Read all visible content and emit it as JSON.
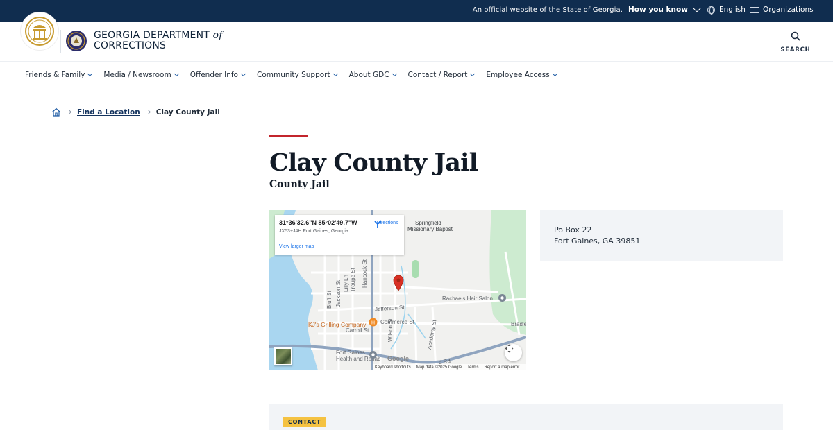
{
  "utility_bar": {
    "official_text": "An official website of the State of Georgia.",
    "how_you_know": "How you know",
    "language": "English",
    "organizations": "Organizations"
  },
  "header": {
    "brand_line1": "GEORGIA DEPARTMENT",
    "brand_of": "of",
    "brand_line2": "CORRECTIONS",
    "search_label": "SEARCH"
  },
  "nav": {
    "items": [
      {
        "label": "Friends & Family"
      },
      {
        "label": "Media / Newsroom"
      },
      {
        "label": "Offender Info"
      },
      {
        "label": "Community Support"
      },
      {
        "label": "About GDC"
      },
      {
        "label": "Contact / Report"
      },
      {
        "label": "Employee Access"
      }
    ]
  },
  "breadcrumb": {
    "parent": "Find a Location",
    "current": "Clay County Jail"
  },
  "page": {
    "title": "Clay County Jail",
    "subtitle": "County Jail"
  },
  "map": {
    "coordinates": "31°36'32.6\"N 85°02'49.7\"W",
    "plus_code": "JX53+J4H Fort Gaines, Georgia",
    "directions": "Directions",
    "view_larger": "View larger map",
    "labels": {
      "springfield_1": "Springfield",
      "springfield_2": "Missionary Baptist",
      "rachaels": "Rachaels Hair Salon",
      "jefferson": "Jefferson St",
      "commerce": "Commerce St",
      "kjs": "KJ's Grilling Company",
      "carroll": "Carroll St",
      "fort_gaines_1": "Fort Gaines",
      "fort_gaines_2": "Health and Rehab",
      "bradley": "Bradley",
      "hancock": "Hancock St",
      "wilson": "Wilson St",
      "academy": "Academy St",
      "troupe": "Troupe St",
      "jackson": "Jackson St",
      "lilly": "Lilly Ln",
      "bluff": "Bluff St",
      "rd": "d Rd",
      "google": "Google"
    },
    "footer": {
      "keyboard": "Keyboard shortcuts",
      "mapdata": "Map data ©2025 Google",
      "terms": "Terms",
      "report": "Report a map error"
    }
  },
  "address": {
    "line1": "Po Box 22",
    "line2": "Fort Gaines, GA 39851"
  },
  "contact": {
    "badge": "CONTACT"
  },
  "colors": {
    "topbar": "#102d4f",
    "accent_red": "#c3252c",
    "link_blue": "#1d5aa3",
    "badge_yellow": "#f5c242",
    "card_bg": "#f2f4f7"
  }
}
